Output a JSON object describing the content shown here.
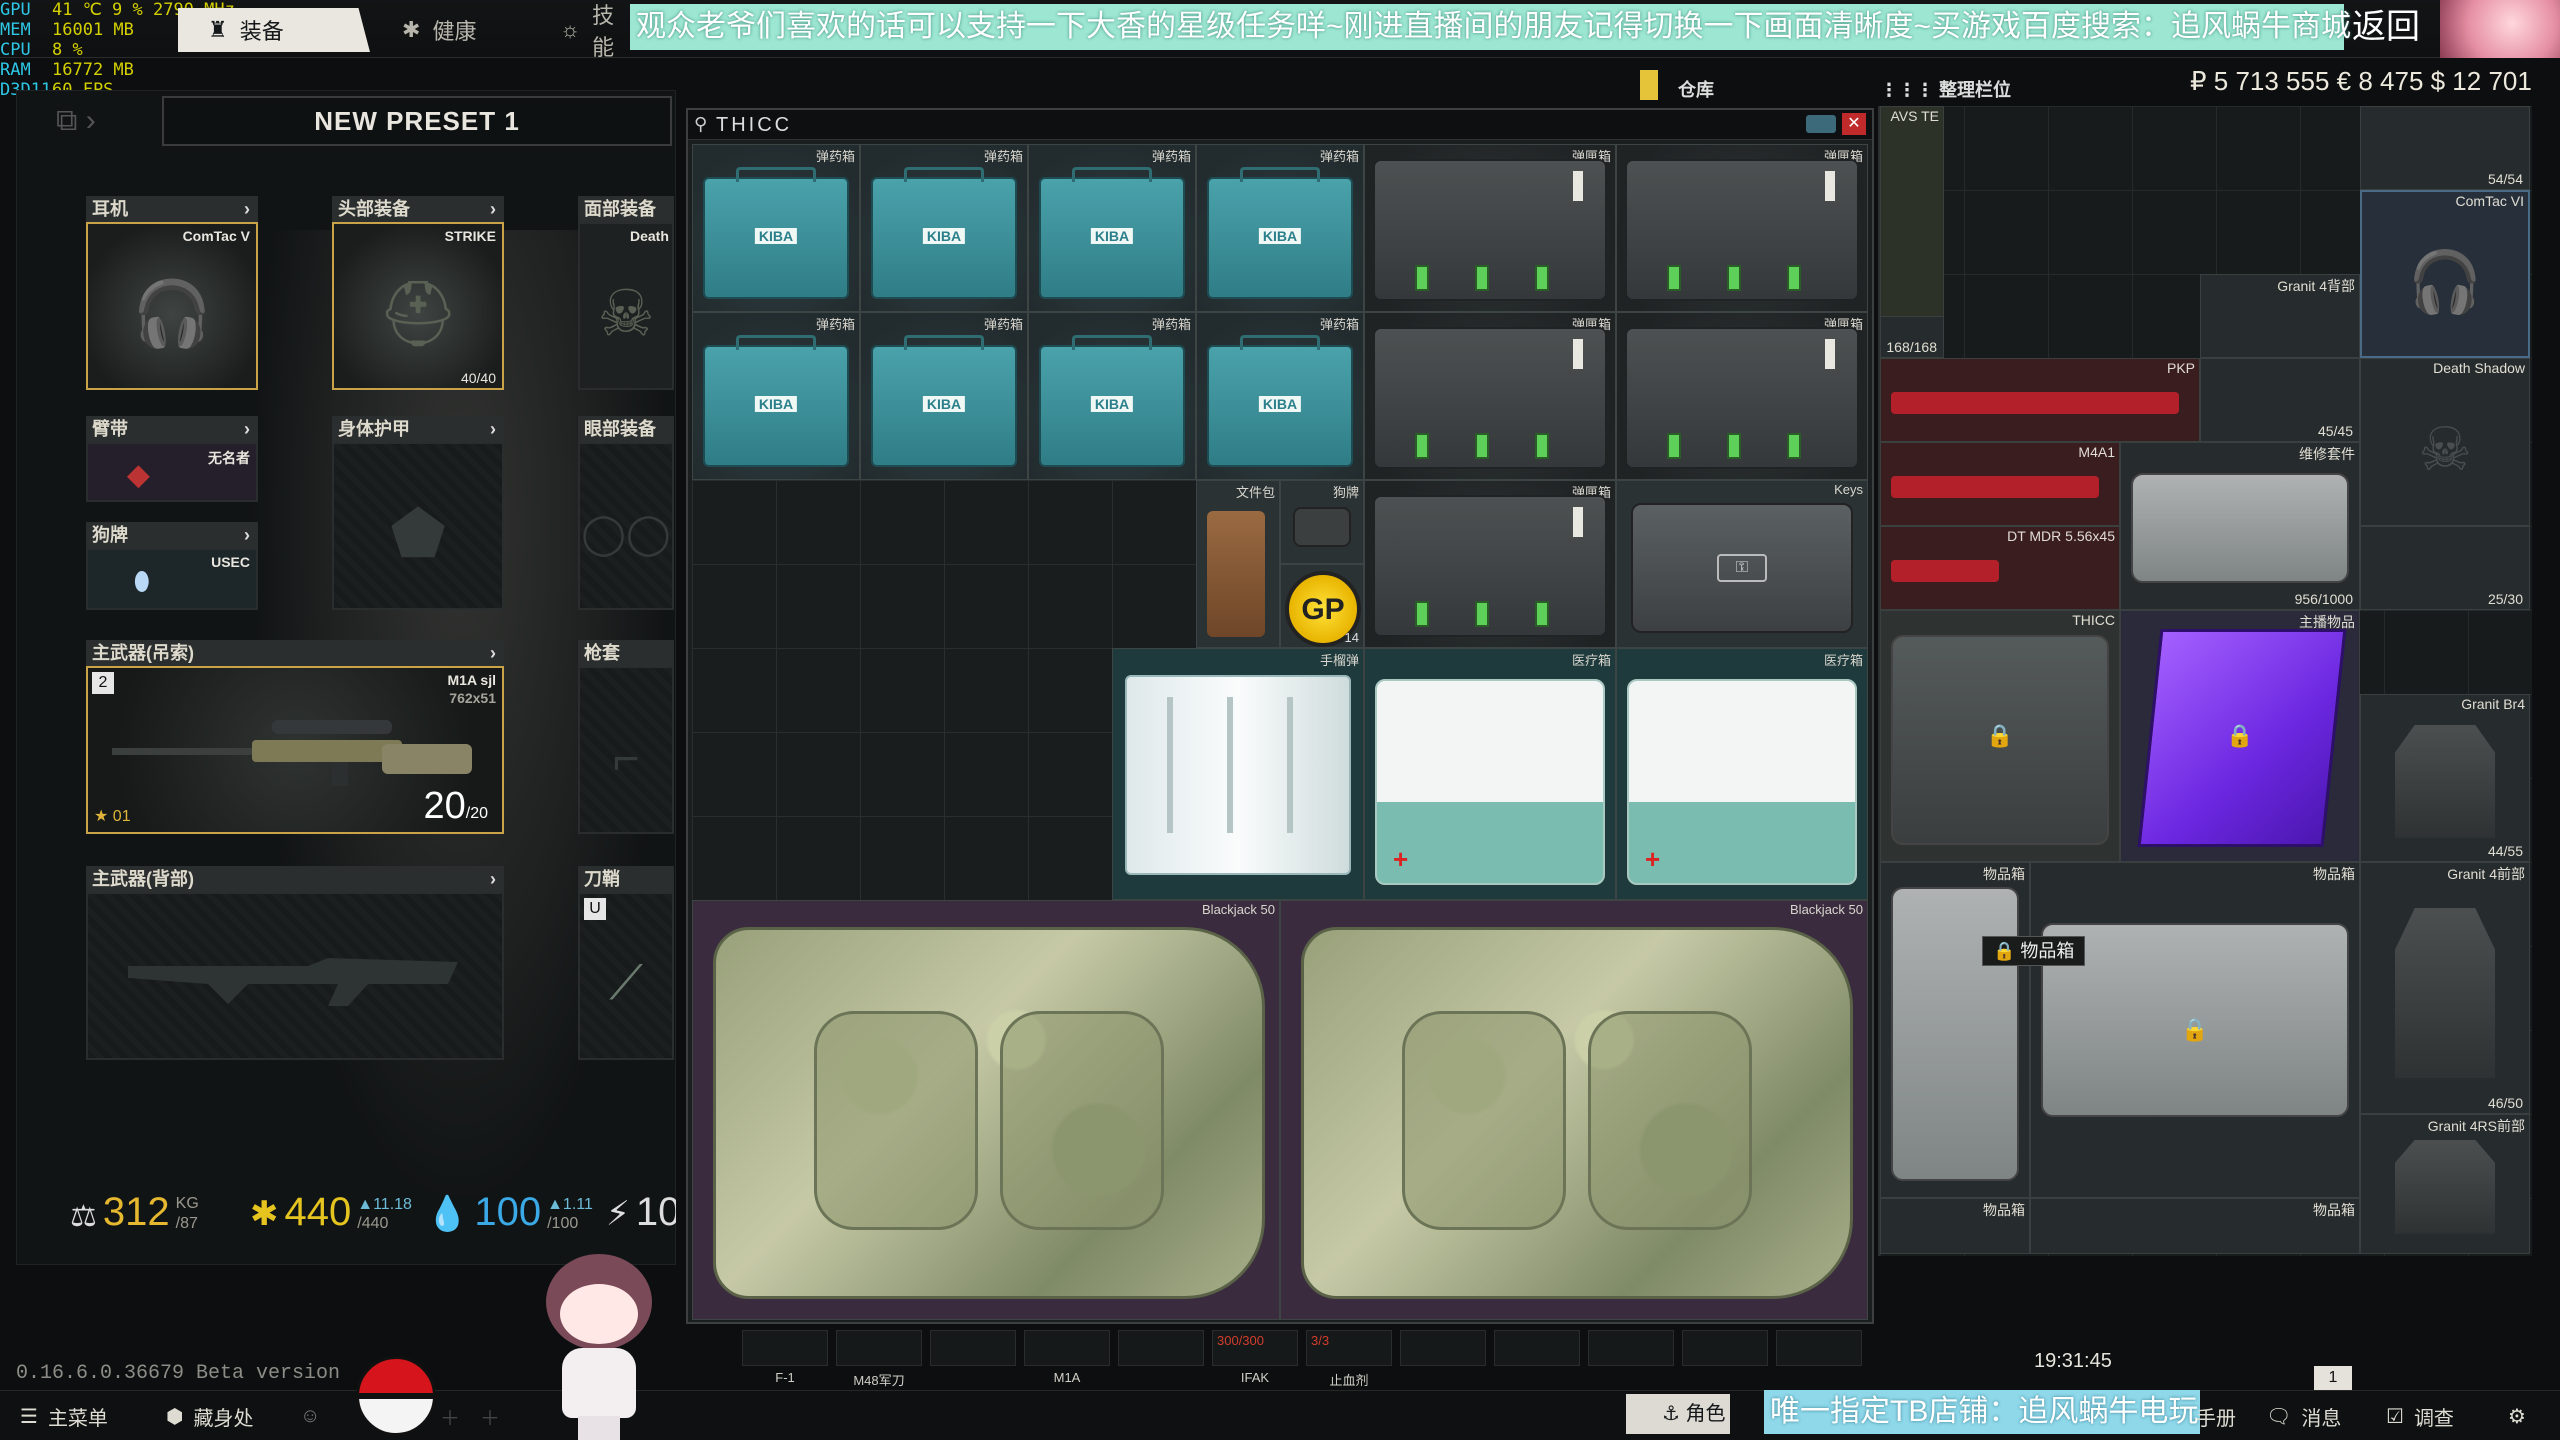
{
  "perf": [
    {
      "key": "GPU",
      "val": "41 ℃  9 %  2790 MHz"
    },
    {
      "key": "MEM",
      "val": "16001 MB"
    },
    {
      "key": "CPU",
      "val": "8 %"
    },
    {
      "key": "RAM",
      "val": "16772 MB"
    },
    {
      "key": "D3D11",
      "val": "60 FPS"
    }
  ],
  "tabs": [
    {
      "label": "装备",
      "icon": "gear-person-icon",
      "active": true
    },
    {
      "label": "健康",
      "icon": "health-icon"
    },
    {
      "label": "技能",
      "icon": "skills-icon"
    }
  ],
  "banner_text": "观众老爷们喜欢的话可以支持一下大香的星级任务咩~刚进直播间的朋友记得切换一下画面清晰度~买游戏百度搜索：追风蜗牛商城",
  "back_label": "返回",
  "preset_name": "NEW PRESET 1",
  "slots": {
    "earpiece": {
      "header": "耳机",
      "item": "ComTac V"
    },
    "headwear": {
      "header": "头部装备",
      "item": "STRIKE",
      "count": "40/40"
    },
    "face_cover": {
      "header": "面部装备",
      "item": "Death"
    },
    "armband": {
      "header": "臂带",
      "item": "无名者"
    },
    "body_armor": {
      "header": "身体护甲"
    },
    "eyewear": {
      "header": "眼部装备"
    },
    "dogtag": {
      "header": "狗牌",
      "item": "USEC"
    },
    "primary_sling": {
      "header": "主武器(吊索)",
      "item": "M1A sjl",
      "caliber": "762x51",
      "ammo": "20",
      "ammo_max": "/20",
      "slot_key": "2",
      "rank": "01"
    },
    "holster": {
      "header": "枪套"
    },
    "primary_back": {
      "header": "主武器(背部)"
    },
    "scabbard": {
      "header": "刀鞘",
      "slot_key": "U"
    }
  },
  "stats": {
    "weight": "312",
    "weight_unit": "KG",
    "weight_max": "/87",
    "energy": "440",
    "energy_rate": "▲11.18",
    "energy_max": "/440",
    "hydration": "100",
    "hydration_rate": "▲1.11",
    "hydration_max": "/100",
    "stamina": "10"
  },
  "version": "0.16.6.0.36679 Beta version",
  "container": {
    "title": "THICC",
    "items": [
      {
        "label": "弹药箱",
        "kind": "kiba"
      },
      {
        "label": "弹药箱",
        "kind": "kiba"
      },
      {
        "label": "弹药箱",
        "kind": "kiba"
      },
      {
        "label": "弹药箱",
        "kind": "kiba"
      },
      {
        "label": "弹匣箱",
        "kind": "mag"
      },
      {
        "label": "弹匣箱",
        "kind": "mag"
      },
      {
        "label": "弹药箱",
        "kind": "kiba"
      },
      {
        "label": "弹药箱",
        "kind": "kiba"
      },
      {
        "label": "弹药箱",
        "kind": "kiba"
      },
      {
        "label": "弹药箱",
        "kind": "kiba"
      },
      {
        "label": "弹匣箱",
        "kind": "mag"
      },
      {
        "label": "弹匣箱",
        "kind": "mag"
      },
      {
        "label": "文件包",
        "kind": "doc"
      },
      {
        "label": "狗牌",
        "kind": "doc"
      },
      {
        "label": "GP",
        "kind": "gp",
        "count": "14"
      },
      {
        "label": "弹匣箱",
        "kind": "mag"
      },
      {
        "label": "Keys",
        "kind": "keys"
      },
      {
        "label": "手榴弹",
        "kind": "gren"
      },
      {
        "label": "医疗箱",
        "kind": "med"
      },
      {
        "label": "医疗箱",
        "kind": "med"
      },
      {
        "label": "Blackjack 50",
        "kind": "bag"
      },
      {
        "label": "Blackjack 50",
        "kind": "bag"
      }
    ],
    "kiba_text": "KIBA",
    "med_cross": "+",
    "keys_glyph": "⚿"
  },
  "hotbar": [
    {
      "label": "F-1"
    },
    {
      "label": "M48军刀"
    },
    {
      "label": ""
    },
    {
      "label": "M1A"
    },
    {
      "label": ""
    },
    {
      "label": "IFAK",
      "sub": "300/300"
    },
    {
      "label": "止血剂",
      "sub": "3/3"
    },
    {
      "label": ""
    },
    {
      "label": ""
    },
    {
      "label": ""
    },
    {
      "label": ""
    },
    {
      "label": ""
    }
  ],
  "stash": {
    "tab_label": "仓库",
    "sort_label": "整理栏位",
    "currency": "₽ 5 713 555   € 8 475   $ 12 701",
    "cells": [
      {
        "label": "AVS TE"
      },
      {
        "label": "",
        "count": "54/54"
      },
      {
        "label": "ComTac VI"
      },
      {
        "label": "",
        "count": "168/168"
      },
      {
        "label": "Granit 4背部"
      },
      {
        "label": "PKP"
      },
      {
        "label": "",
        "count": "45/45"
      },
      {
        "label": "Death Shadow"
      },
      {
        "label": "M4A1"
      },
      {
        "label": "维修套件",
        "count": "956/1000"
      },
      {
        "label": "DT MDR 5.56x45"
      },
      {
        "label": "",
        "count": "25/30"
      },
      {
        "label": "THICC"
      },
      {
        "label": "主播物品"
      },
      {
        "label": "Granit Br4",
        "count": "44/55"
      },
      {
        "label": "物品箱"
      },
      {
        "label": "物品箱"
      },
      {
        "label": "Granit 4前部",
        "count": "46/50"
      },
      {
        "label": "Granit 4RS前部"
      },
      {
        "label": "物品箱"
      },
      {
        "label": "物品箱"
      }
    ],
    "tooltip": "物品箱"
  },
  "bottom": {
    "menu": "主菜单",
    "hideout": "藏身处",
    "time": "19:31:45",
    "character": "角色",
    "banner": "唯一指定TB店铺：追风蜗牛电玩",
    "handbook": "手册",
    "messages": "消息",
    "survey": "调查",
    "notif_count": "1"
  }
}
